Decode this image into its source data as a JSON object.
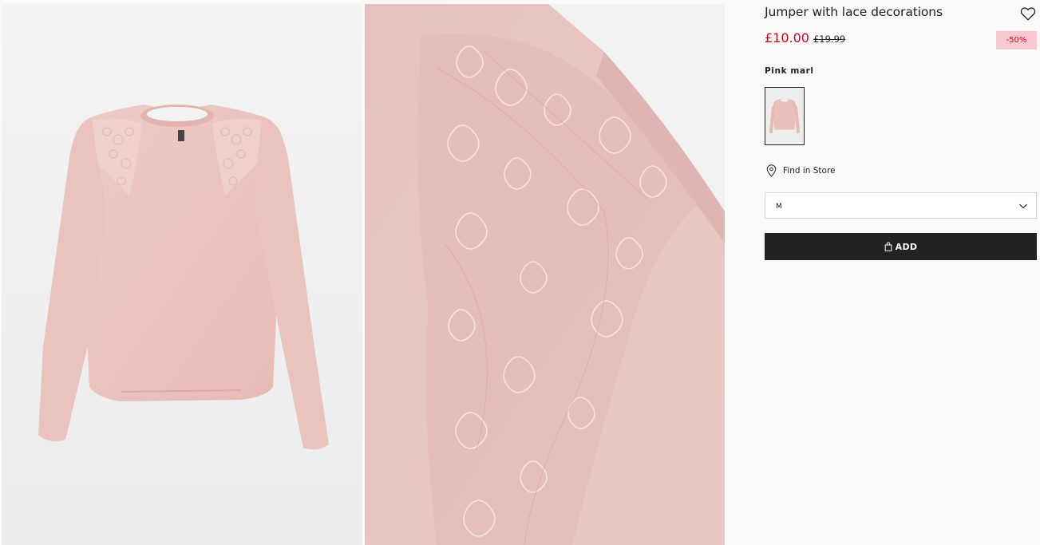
{
  "product": {
    "title": "Jumper with lace decorations",
    "price_now": "£10.00",
    "price_old": "£19.99",
    "discount": "-50%",
    "color_name": "Pink marl",
    "find_in_store": "Find in Store",
    "size_selected": "M",
    "add_label": "ADD"
  },
  "colors": {
    "sale_red": "#d6001c",
    "discount_bg": "#f7c8cf",
    "button_bg": "#222222",
    "jumper_pink": "#ecc2be"
  },
  "icons": {
    "favorite": "heart-outline-icon",
    "store": "map-pin-icon",
    "select": "chevron-down-icon",
    "add": "shopping-bag-icon"
  }
}
